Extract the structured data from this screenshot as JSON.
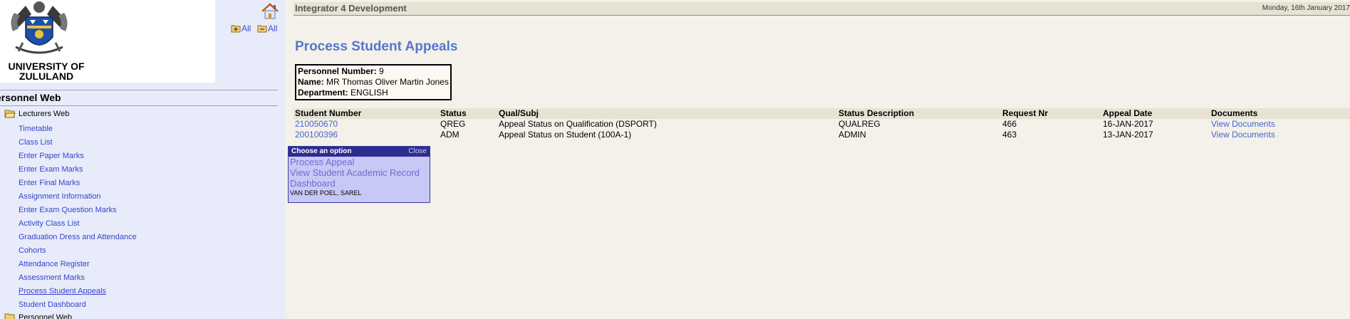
{
  "sidebar": {
    "university_name_line1": "UNIVERSITY OF",
    "university_name_line2": "ZULULAND",
    "expand_all_label": "All",
    "collapse_all_label": "All",
    "section_title": "ersonnel Web",
    "folders": [
      {
        "label": "Lecturers Web",
        "open": true
      },
      {
        "label": "Personnel Web",
        "open": false
      }
    ],
    "items": [
      {
        "label": "Timetable"
      },
      {
        "label": "Class List"
      },
      {
        "label": "Enter Paper Marks"
      },
      {
        "label": "Enter Exam Marks"
      },
      {
        "label": "Enter Final Marks"
      },
      {
        "label": "Assignment Information"
      },
      {
        "label": "Enter Exam Question Marks"
      },
      {
        "label": "Activity Class List"
      },
      {
        "label": "Graduation Dress and Attendance"
      },
      {
        "label": "Cohorts"
      },
      {
        "label": "Attendance Register"
      },
      {
        "label": "Assessment Marks"
      },
      {
        "label": "Process Student Appeals",
        "current": true
      },
      {
        "label": "Student Dashboard"
      }
    ]
  },
  "header": {
    "app_title": "Integrator 4 Development",
    "date": "Monday, 16th January 2017"
  },
  "page": {
    "title": "Process Student Appeals",
    "personnel": {
      "number_label": "Personnel Number:",
      "number_value": "9",
      "name_label": "Name:",
      "name_value": "MR Thomas Oliver Martin Jones",
      "dept_label": "Department:",
      "dept_value": "ENGLISH"
    }
  },
  "table": {
    "columns": [
      "Student Number",
      "Status",
      "Qual/Subj",
      "Status Description",
      "Request Nr",
      "Appeal Date",
      "Documents"
    ],
    "rows": [
      {
        "student_number": "210050670",
        "status": "QREG",
        "qual_subj": "Appeal Status on Qualification (DSPORT)",
        "status_description": "QUALREG",
        "request_nr": "466",
        "appeal_date": "16-JAN-2017",
        "documents": "View Documents"
      },
      {
        "student_number": "200100396",
        "status": "ADM",
        "qual_subj": "Appeal Status on Student (100A-1)",
        "status_description": "ADMIN",
        "request_nr": "463",
        "appeal_date": "13-JAN-2017",
        "documents": "View Documents"
      }
    ]
  },
  "popup": {
    "title": "Choose an option",
    "close_label": "Close",
    "options": [
      "Process Appeal",
      "View Student Academic Record",
      "Dashboard"
    ],
    "student_name": "VAN DER POEL, SAREL"
  },
  "colors": {
    "link": "#4466cc",
    "nav_link": "#3344cc",
    "page_title": "#5577cc",
    "popup_header": "#2d2d8f",
    "popup_bg": "#c8c8f6"
  },
  "icons": [
    "university-crest-icon",
    "home-icon",
    "expand-all-icon",
    "collapse-all-icon",
    "folder-open-icon",
    "folder-closed-icon"
  ]
}
